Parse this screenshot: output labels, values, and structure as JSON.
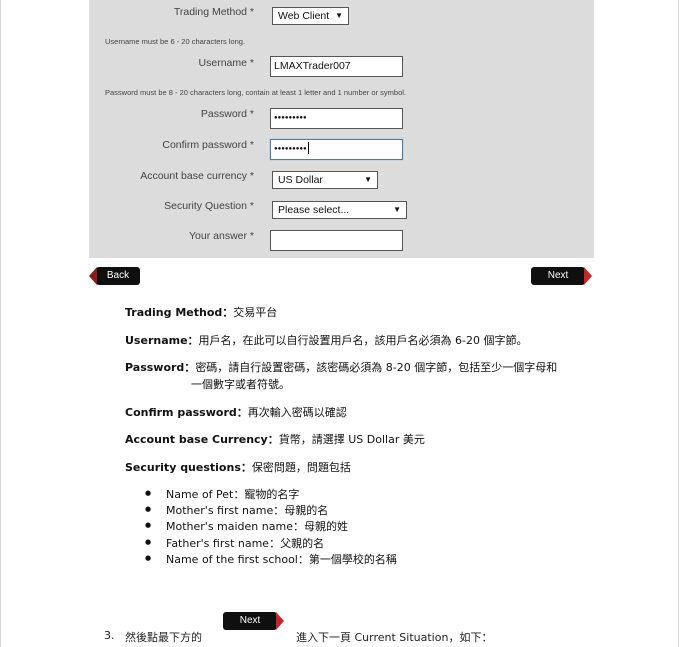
{
  "form": {
    "trading_method_label": "Trading Method *",
    "trading_method_value": "Web Client",
    "username_hint": "Username must be 6 - 20 characters long.",
    "username_label": "Username *",
    "username_value": "LMAXTrader007",
    "password_hint": "Password must be 8 - 20 characters long, contain at least 1 letter and 1 number or symbol.",
    "password_label": "Password *",
    "password_value": "●●●●●●●●●",
    "confirm_password_label": "Confirm password *",
    "confirm_password_value": "●●●●●●●●●",
    "currency_label": "Account base currency *",
    "currency_value": "US Dollar",
    "security_question_label": "Security Question *",
    "security_question_value": "Please select...",
    "answer_label": "Your answer *",
    "answer_value": ""
  },
  "nav": {
    "back_label": "Back",
    "next_label": "Next"
  },
  "explanations": {
    "trading_method_term": "Trading Method：",
    "trading_method_desc": "交易平台",
    "username_term": "Username：",
    "username_desc": "用戶名，在此可以自行設置用戶名，該用戶名必須為 6-20 個字節。",
    "password_term": "Password：",
    "password_desc_line1": "密碼，請自行設置密碼，該密碼必須為 8-20 個字節，包括至少一個字母和",
    "password_desc_line2": "一個數字或者符號。",
    "confirm_term": "Confirm password：",
    "confirm_desc": "再次輸入密碼以確認",
    "currency_term": "Account base Currency：",
    "currency_desc": "貨幣，請選擇 US Dollar 美元",
    "security_term": "Security questions：",
    "security_desc": "保密問題，問題包括"
  },
  "security_questions": [
    "Name of Pet：寵物的名字",
    "Mother's first name：母親的名",
    "Mother's maiden name：母親的姓",
    "Father's first name：父親的名",
    "Name of the first school：第一個學校的名稱"
  ],
  "step3": {
    "number": "3.",
    "before": "然後點最下方的",
    "button_label": "Next",
    "after": "進入下一頁 Current Situation，如下："
  },
  "icons": {
    "dropdown": "chevron-down-icon"
  }
}
